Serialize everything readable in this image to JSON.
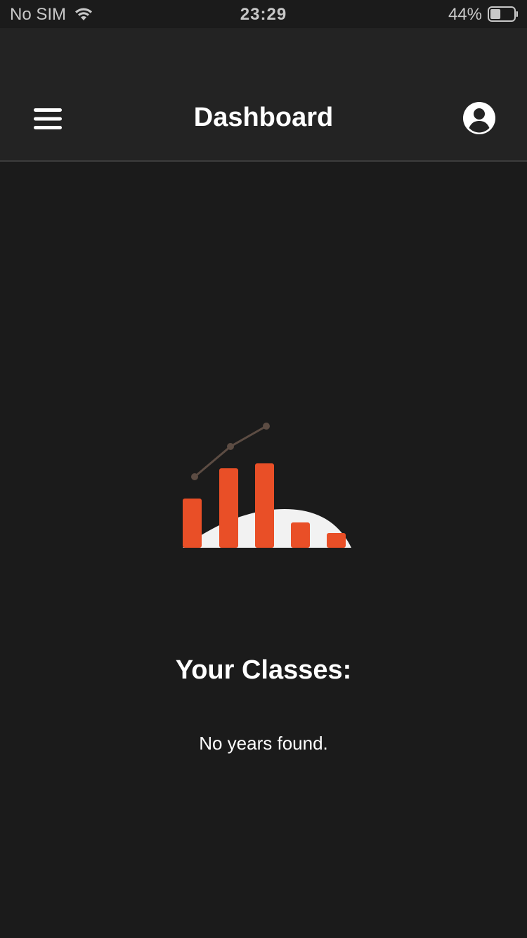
{
  "status_bar": {
    "carrier": "No SIM",
    "time": "23:29",
    "battery_percent": "44%",
    "battery_level": 0.44,
    "wifi_icon": "wifi-icon",
    "battery_icon": "battery-icon"
  },
  "header": {
    "title": "Dashboard",
    "menu_icon": "hamburger-menu-icon",
    "profile_icon": "user-circle-icon"
  },
  "main": {
    "illustration": "empty-chart-illustration",
    "section_title": "Your Classes:",
    "empty_message": "No years found."
  },
  "colors": {
    "background": "#1b1b1b",
    "header_background": "#232323",
    "accent": "#e94f27",
    "line": "#5c4c43",
    "hill": "#f2f2f2",
    "text": "#ffffff"
  }
}
